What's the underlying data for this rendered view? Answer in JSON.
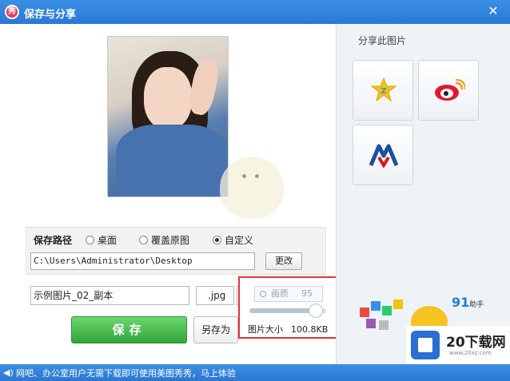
{
  "window": {
    "title": "保存与分享",
    "logo_text": "秀",
    "close": "✕"
  },
  "save_path": {
    "label": "保存路径",
    "options": [
      {
        "label": "桌面",
        "selected": false
      },
      {
        "label": "覆盖原图",
        "selected": false
      },
      {
        "label": "自定义",
        "selected": true
      }
    ],
    "path": "C:\\Users\\Administrator\\Desktop",
    "change_button": "更改"
  },
  "file": {
    "name": "示例图片_02_副本",
    "extension": ".jpg",
    "dropdown_arrow": "▼"
  },
  "quality": {
    "label": "画质",
    "value": "95",
    "slider_fraction": 0.95,
    "size_label": "图片大小",
    "size_value": "100.8KB"
  },
  "buttons": {
    "save": "保存",
    "save_as": "另存为"
  },
  "share": {
    "title": "分享此图片"
  },
  "ad": {
    "brand": "91",
    "sub": "助手"
  },
  "watermark": {
    "text": "20下载网",
    "url": "www.20xz.com"
  },
  "statusbar": {
    "text": "网吧、办公室用户无需下载即可使用美图秀秀，马上体验"
  }
}
